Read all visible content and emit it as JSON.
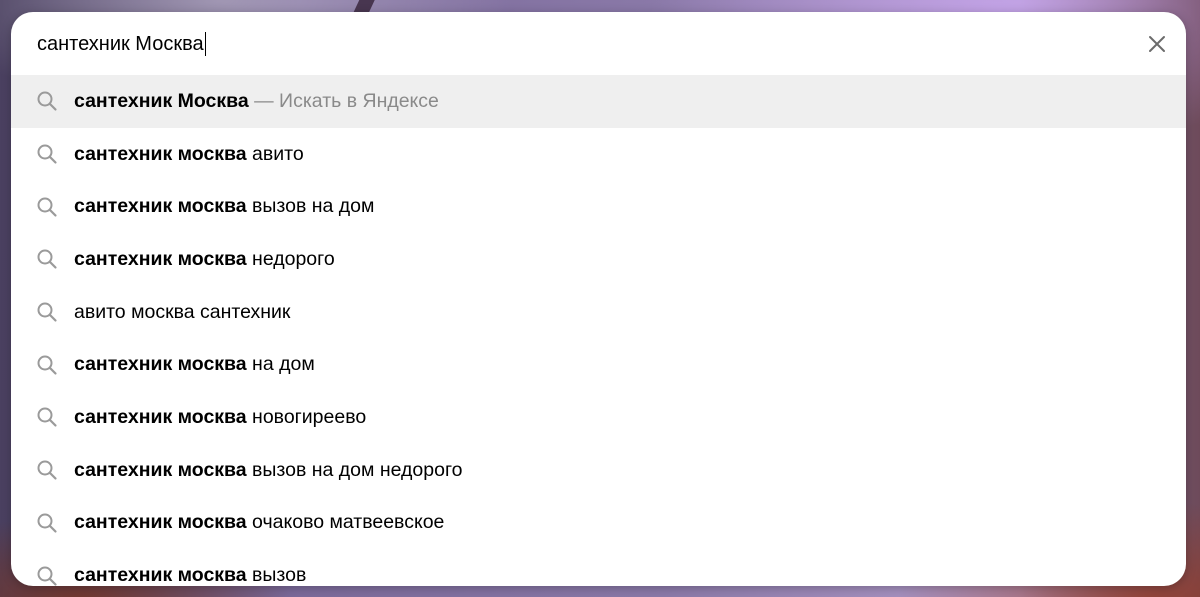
{
  "search": {
    "query": "сантехник Москва",
    "close_icon": "close-icon",
    "suggestion_icon": "search-icon"
  },
  "suggestions": [
    {
      "bold": "сантехник Москва",
      "rest": "",
      "hint": " — Искать в Яндексе",
      "active": true
    },
    {
      "bold": "сантехник москва",
      "rest": " авито",
      "hint": ""
    },
    {
      "bold": "сантехник москва",
      "rest": " вызов на дом",
      "hint": ""
    },
    {
      "bold": "сантехник москва",
      "rest": " недорого",
      "hint": ""
    },
    {
      "bold": "",
      "rest": "авито москва сантехник",
      "hint": ""
    },
    {
      "bold": "сантехник москва",
      "rest": " на дом",
      "hint": ""
    },
    {
      "bold": "сантехник москва",
      "rest": " новогиреево",
      "hint": ""
    },
    {
      "bold": "сантехник москва",
      "rest": " вызов на дом недорого",
      "hint": ""
    },
    {
      "bold": "сантехник москва",
      "rest": " очаково матвеевское",
      "hint": ""
    },
    {
      "bold": "сантехник москва",
      "rest": " вызов",
      "hint": ""
    }
  ]
}
